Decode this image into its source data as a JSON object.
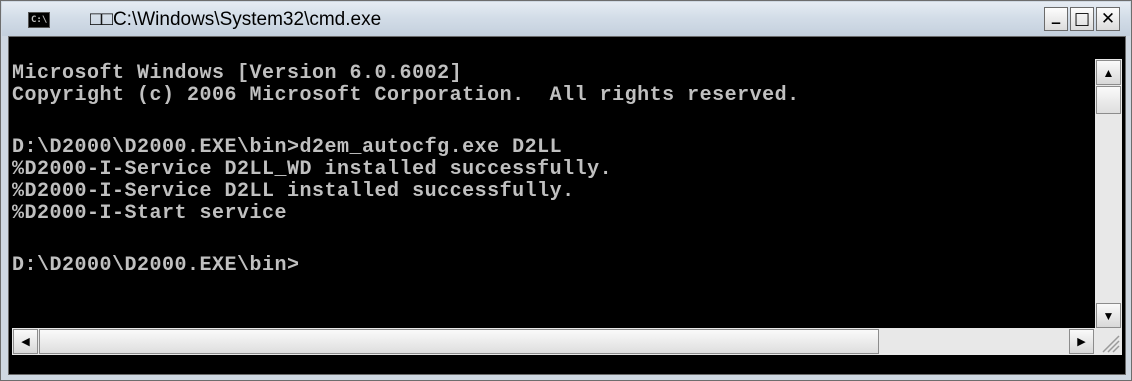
{
  "window": {
    "title": "□□C:\\Windows\\System32\\cmd.exe",
    "icon": "cmd-icon",
    "minimize_glyph": "_",
    "maximize_glyph": "□",
    "close_glyph": "✕"
  },
  "console": {
    "lines": [
      "Microsoft Windows [Version 6.0.6002]",
      "Copyright (c) 2006 Microsoft Corporation.  All rights reserved.",
      "",
      "D:\\D2000\\D2000.EXE\\bin>d2em_autocfg.exe D2LL",
      "%D2000-I-Service D2LL_WD installed successfully.",
      "%D2000-I-Service D2LL installed successfully.",
      "%D2000-I-Start service",
      "",
      "D:\\D2000\\D2000.EXE\\bin>"
    ]
  },
  "scrollbars": {
    "up_glyph": "▲",
    "down_glyph": "▼",
    "left_glyph": "◀",
    "right_glyph": "▶"
  }
}
